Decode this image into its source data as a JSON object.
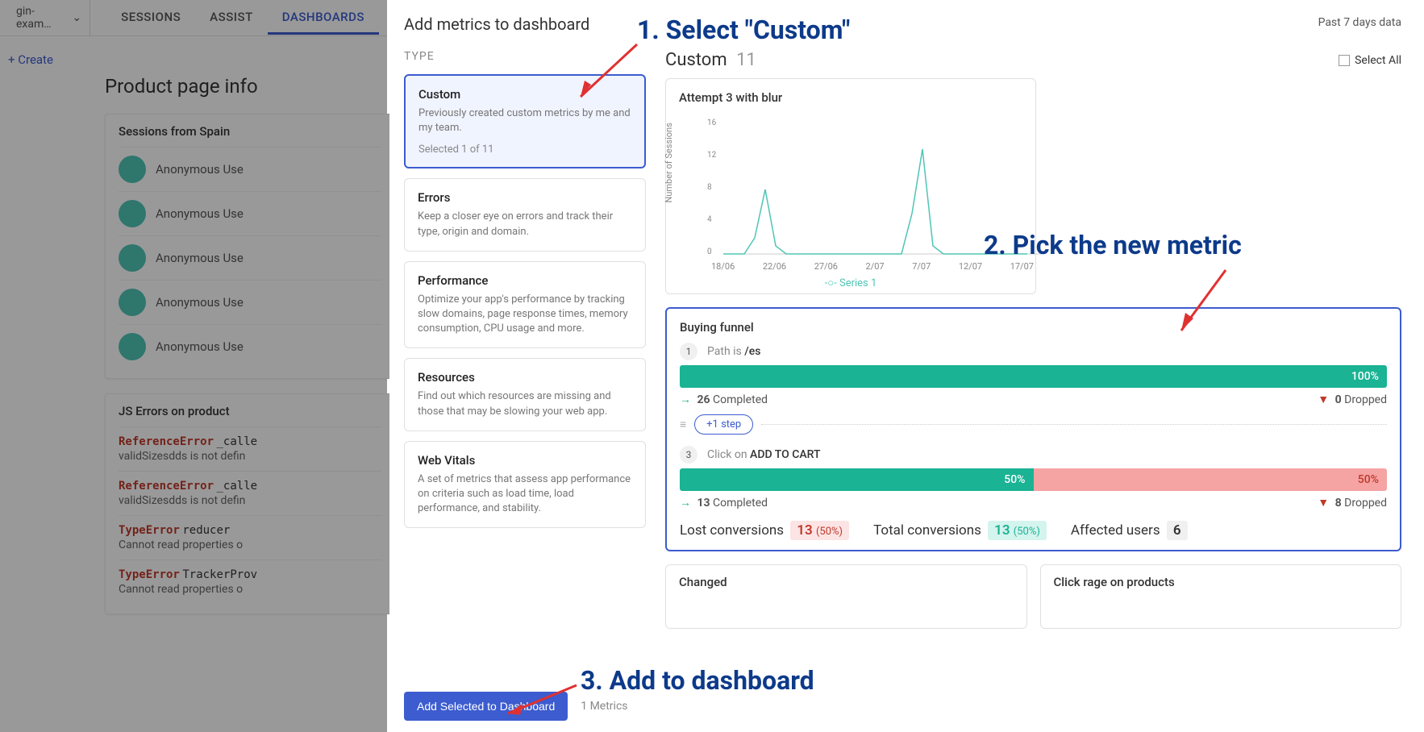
{
  "bg": {
    "project": "gin-exam…",
    "tabs": {
      "sessions": "SESSIONS",
      "assist": "ASSIST",
      "dashboards": "DASHBOARDS"
    },
    "create": "+ Create",
    "page_title": "Product page info",
    "card1_title": "Sessions from Spain",
    "user": "Anonymous Use",
    "card2_title": "JS Errors on product",
    "errors": [
      {
        "type": "ReferenceError",
        "msg": "_calle",
        "detail": "validSizesdds is not defin"
      },
      {
        "type": "ReferenceError",
        "msg": "_calle",
        "detail": "validSizesdds is not defin"
      },
      {
        "type": "TypeError",
        "msg": "reducer",
        "detail": "Cannot read properties o"
      },
      {
        "type": "TypeError",
        "msg": "TrackerProv",
        "detail": "Cannot read properties o"
      }
    ]
  },
  "modal": {
    "title": "Add metrics to dashboard",
    "time_range": "Past 7 days data",
    "type_label": "TYPE",
    "selectall": "Select All",
    "types": [
      {
        "name": "Custom",
        "desc": "Previously created custom metrics by me and my team.",
        "selected": "Selected 1 of 11"
      },
      {
        "name": "Errors",
        "desc": "Keep a closer eye on errors and track their type, origin and domain."
      },
      {
        "name": "Performance",
        "desc": "Optimize your app's performance by tracking slow domains, page response times, memory consumption, CPU usage and more."
      },
      {
        "name": "Resources",
        "desc": "Find out which resources are missing and those that may be slowing your web app."
      },
      {
        "name": "Web Vitals",
        "desc": "A set of metrics that assess app performance on criteria such as load time, load performance, and stability."
      }
    ],
    "metrics_title": "Custom",
    "metrics_count": "11",
    "chart": {
      "title": "Attempt 3 with blur",
      "ylabel": "Number of Sessions",
      "legend": "Series 1",
      "xticks": [
        "18/06",
        "22/06",
        "27/06",
        "2/07",
        "7/07",
        "12/07",
        "17/07"
      ]
    },
    "funnel": {
      "title": "Buying funnel",
      "step1": {
        "num": "1",
        "pre": "Path",
        "mid": "is",
        "val": "/es",
        "pct": "100%",
        "completed": "26",
        "completed_label": "Completed",
        "dropped": "0",
        "dropped_label": "Dropped"
      },
      "add_step": "+1 step",
      "step3": {
        "num": "3",
        "pre": "Click",
        "mid": "on",
        "val": "ADD TO CART",
        "pct_g": "50%",
        "pct_r": "50%",
        "completed": "13",
        "completed_label": "Completed",
        "dropped": "8",
        "dropped_label": "Dropped"
      },
      "summary": {
        "lost_label": "Lost conversions",
        "lost_val": "13",
        "lost_pct": "(50%)",
        "total_label": "Total conversions",
        "total_val": "13",
        "total_pct": "(50%)",
        "affected_label": "Affected users",
        "affected_val": "6"
      }
    },
    "small1": "Changed",
    "small2": "Click rage on products",
    "footer_btn": "Add Selected to Dashboard",
    "footer_count": "1 Metrics"
  },
  "anno": {
    "a1": "1. Select \"Custom\"",
    "a2": "2. Pick the new metric",
    "a3": "3. Add to dashboard"
  },
  "chart_data": {
    "type": "line",
    "title": "Attempt 3 with blur",
    "ylabel": "Number of Sessions",
    "ylim": [
      0,
      16
    ],
    "x": [
      "18/06",
      "19/06",
      "20/06",
      "21/06",
      "22/06",
      "23/06",
      "24/06",
      "25/06",
      "26/06",
      "27/06",
      "28/06",
      "29/06",
      "30/06",
      "1/07",
      "2/07",
      "3/07",
      "4/07",
      "5/07",
      "6/07",
      "7/07",
      "8/07",
      "9/07",
      "10/07",
      "11/07",
      "12/07",
      "13/07",
      "14/07",
      "15/07",
      "16/07",
      "17/07"
    ],
    "series": [
      {
        "name": "Series 1",
        "values": [
          0,
          0,
          0,
          2,
          8,
          1,
          0,
          0,
          0,
          0,
          0,
          0,
          0,
          0,
          0,
          0,
          0,
          0,
          5,
          13,
          1,
          0,
          0,
          0,
          0,
          0,
          0,
          0,
          0,
          0
        ]
      }
    ]
  }
}
